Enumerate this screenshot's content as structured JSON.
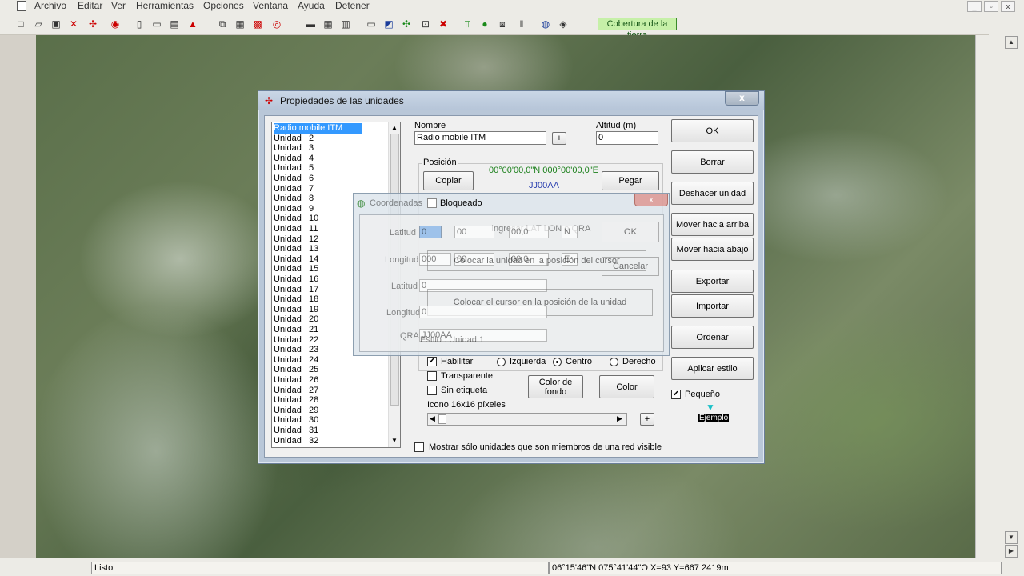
{
  "menu": [
    "Archivo",
    "Editar",
    "Ver",
    "Herramientas",
    "Opciones",
    "Ventana",
    "Ayuda",
    "Detener"
  ],
  "toolbar": {
    "earth_button": "Cobertura de la tierra"
  },
  "status": {
    "left": "Listo",
    "right": "06°15'46\"N 075°41'44\"O  X=93 Y=667 2419m"
  },
  "dialog": {
    "title": "Propiedades de las unidades",
    "close_label": "x",
    "units": [
      "Radio mobile ITM",
      "Unidad   2",
      "Unidad   3",
      "Unidad   4",
      "Unidad   5",
      "Unidad   6",
      "Unidad   7",
      "Unidad   8",
      "Unidad   9",
      "Unidad   10",
      "Unidad   11",
      "Unidad   12",
      "Unidad   13",
      "Unidad   14",
      "Unidad   15",
      "Unidad   16",
      "Unidad   17",
      "Unidad   18",
      "Unidad   19",
      "Unidad   20",
      "Unidad   21",
      "Unidad   22",
      "Unidad   23",
      "Unidad   24",
      "Unidad   25",
      "Unidad   26",
      "Unidad   27",
      "Unidad   28",
      "Unidad   29",
      "Unidad   30",
      "Unidad   31",
      "Unidad   32"
    ],
    "name_label": "Nombre",
    "name_value": "Radio mobile ITM",
    "plus": "+",
    "altitude_label": "Altitud (m)",
    "altitude_value": "0",
    "position_label": "Posición",
    "copy": "Copiar",
    "paste": "Pegar",
    "coords": "00°00'00,0\"N 000°00'00,0\"E",
    "qra": "JJ00AA",
    "buttons": {
      "ok": "OK",
      "delete": "Borrar",
      "undo": "Deshacer unidad",
      "move_up": "Mover hacia arriba",
      "move_down": "Mover hacia abajo",
      "export": "Exportar",
      "import": "Importar",
      "sort": "Ordenar",
      "apply_style": "Aplicar estilo"
    },
    "style": {
      "enable": "Habilitar",
      "left": "Izquierda",
      "center": "Centro",
      "right": "Derecho",
      "transparent": "Transparente",
      "no_label": "Sin etiqueta",
      "bg_color": "Color de fondo",
      "color": "Color",
      "icon": "Icono 16x16 píxeles",
      "small": "Pequeño",
      "example": "Ejemplo",
      "style_caption": "Estilo : Unidad   1"
    },
    "show_only": "Mostrar sólo unidades que son miembros de una red visible"
  },
  "coord_dialog": {
    "title": "Coordenadas",
    "locked": "Bloqueado",
    "enter_hint": "Ingresar LAT LON o QRA",
    "lat_label": "Latitud",
    "lon_label": "Longitud",
    "lat_deg": "0",
    "lat_min": "00",
    "lat_sec": "00,0",
    "lon_deg": "000",
    "lon_min": "00",
    "lon_sec": "00,0",
    "hemi_n": "N",
    "hemi_e": "E",
    "lat_dec_label": "Latitud",
    "lat_dec": "0",
    "lon_dec_label": "Longitud",
    "lon_dec": "0",
    "qra_label": "QRA",
    "qra_value": "JJ00AA",
    "ok": "OK",
    "cancel": "Cancelar",
    "place_unit": "Colocar la unidad en la posición del cursor",
    "place_cursor": "Colocar el cursor en la posición de la unidad"
  }
}
